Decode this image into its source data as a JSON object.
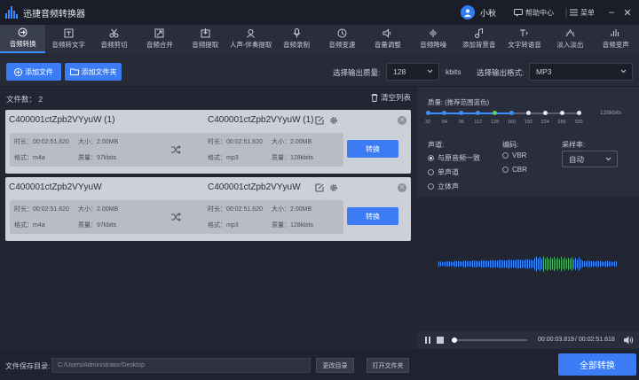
{
  "app": {
    "title": "迅捷音频转换器",
    "user": "小秋",
    "help": "帮助中心",
    "menu": "菜单"
  },
  "tools": [
    {
      "label": "音频转换",
      "icon": "convert-icon",
      "active": true
    },
    {
      "label": "音频转文字",
      "icon": "text-icon"
    },
    {
      "label": "音频剪切",
      "icon": "scissors-icon"
    },
    {
      "label": "音频合并",
      "icon": "merge-icon"
    },
    {
      "label": "音频提取",
      "icon": "extract-icon"
    },
    {
      "label": "人声-伴奏提取",
      "icon": "voice-icon"
    },
    {
      "label": "音频录制",
      "icon": "mic-icon"
    },
    {
      "label": "音频变速",
      "icon": "speed-icon"
    },
    {
      "label": "音量调整",
      "icon": "volume-icon"
    },
    {
      "label": "音频降噪",
      "icon": "denoise-icon"
    },
    {
      "label": "添加背景音",
      "icon": "bgm-icon"
    },
    {
      "label": "文字转语音",
      "icon": "tts-icon"
    },
    {
      "label": "淡入淡出",
      "icon": "fade-icon"
    },
    {
      "label": "音频变声",
      "icon": "voicechange-icon"
    }
  ],
  "actions": {
    "add_file": "添加文件",
    "add_folder": "添加文件夹",
    "quality_label": "选择输出质量:",
    "quality_value": "128",
    "quality_unit": "kbits",
    "format_label": "选择输出格式:",
    "format_value": "MP3"
  },
  "filelist": {
    "count_label": "文件数：",
    "count": "2",
    "clear": "清空列表"
  },
  "files": [
    {
      "src_name": "C400001ctZpb2VYyuW (1)",
      "dst_name": "C400001ctZpb2VYyuW (1)",
      "src_duration": "时长：00:02:51.620",
      "src_size": "大小：2.00MB",
      "src_format": "格式：m4a",
      "src_quality": "质量：97kbits",
      "dst_duration": "时长：00:02:51.620",
      "dst_size": "大小：2.00MB",
      "dst_format": "格式：mp3",
      "dst_quality": "质量：128kbits",
      "convert": "转换"
    },
    {
      "src_name": "C400001ctZpb2VYyuW",
      "dst_name": "C400001ctZpb2VYyuW",
      "src_duration": "时长：00:02:51.620",
      "src_size": "大小：2.00MB",
      "src_format": "格式：m4a",
      "src_quality": "质量：97kbits",
      "dst_duration": "时长：00:02:51.620",
      "dst_size": "大小：2.00MB",
      "dst_format": "格式：mp3",
      "dst_quality": "质量：128kbits",
      "convert": "转换"
    }
  ],
  "settings": {
    "quality_title": "质量: (推荐范围蓝色)",
    "quality_ticks": [
      "32",
      "64",
      "96",
      "112",
      "128",
      "160",
      "192",
      "224",
      "256",
      "320"
    ],
    "quality_selected": "128",
    "quality_unit": "128kbits",
    "channel_label": "声道:",
    "channel_options": [
      "与原音频一致",
      "单声道",
      "立体声"
    ],
    "encode_label": "编码:",
    "encode_options": [
      "VBR",
      "CBR"
    ],
    "samplerate_label": "采样率:",
    "samplerate_value": "自动"
  },
  "player": {
    "current": "00:00:03.819",
    "total": "/ 00:02:51.618",
    "progress": 0.02
  },
  "bottom": {
    "save_label": "文件保存目录:",
    "path": "C:/Users/Administrator/Desktop",
    "change_dir": "更改目录",
    "open_folder": "打开文件夹",
    "convert_all": "全部转换"
  },
  "colors": {
    "accent": "#3b7cf5",
    "bg": "#222633"
  }
}
